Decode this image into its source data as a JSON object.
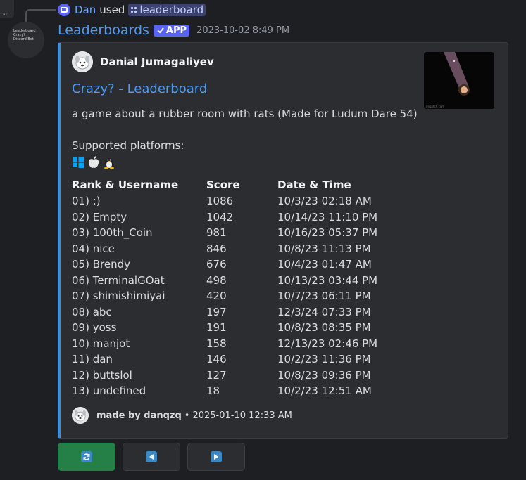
{
  "reply": {
    "user_name": "Dan",
    "used_text": "used",
    "command": "leaderboard"
  },
  "message": {
    "bot_name": "Leaderboards",
    "app_badge": "APP",
    "timestamp": "2023-10-02 8:49 PM"
  },
  "avatar_lines": [
    "Leaderboard",
    "Crazy?",
    "Discord Bot"
  ],
  "embed": {
    "accent_color": "#3e8ee0",
    "author": "Danial Jumagaliyev",
    "title": "Crazy? - Leaderboard",
    "description": "a game about a rubber room with rats (Made for Ludum Dare 54)",
    "platforms_label": "Supported platforms:",
    "platforms": [
      "windows-icon",
      "apple-icon",
      "linux-icon"
    ],
    "thumbnail_caption": "img/itch.com",
    "table": {
      "headers": [
        "Rank & Username",
        "Score",
        "Date & Time"
      ],
      "rows": [
        [
          "01) :)",
          "1086",
          "10/3/23 02:18 AM"
        ],
        [
          "02) Empty",
          "1042",
          "10/14/23 11:10 PM"
        ],
        [
          "03) 100th_Coin",
          "981",
          "10/16/23 05:37 PM"
        ],
        [
          "04) nice",
          "846",
          "10/8/23 11:13 PM"
        ],
        [
          "05) Brendy",
          "676",
          "10/4/23 01:47 AM"
        ],
        [
          "06) TerminalGOat",
          "498",
          "10/13/23 03:44 PM"
        ],
        [
          "07) shimishimiyai",
          "420",
          "10/7/23 06:11 PM"
        ],
        [
          "08) abc",
          "197",
          "12/3/24 07:33 PM"
        ],
        [
          "09) yoss",
          "191",
          "10/8/23 08:35 PM"
        ],
        [
          "10) manjot",
          "158",
          "12/13/23 02:46 PM"
        ],
        [
          "11) dan",
          "146",
          "10/2/23 11:36 PM"
        ],
        [
          "12) buttslol",
          "127",
          "10/8/23 09:36 PM"
        ],
        [
          "13) undefined",
          "18",
          "10/2/23 12:51 AM"
        ]
      ]
    },
    "footer": {
      "text": "made by danqzq",
      "separator": "•",
      "time": "2025-01-10 12:33 AM"
    }
  },
  "buttons": [
    {
      "name": "refresh-button",
      "icon": "refresh-icon",
      "style": "success"
    },
    {
      "name": "previous-page-button",
      "icon": "arrow-left-icon",
      "style": "secondary"
    },
    {
      "name": "next-page-button",
      "icon": "arrow-right-icon",
      "style": "secondary"
    }
  ],
  "colors": {
    "background": "#1e1f22",
    "link": "#4d9bf8",
    "app_badge": "#5865f2",
    "success_button": "#248046"
  }
}
